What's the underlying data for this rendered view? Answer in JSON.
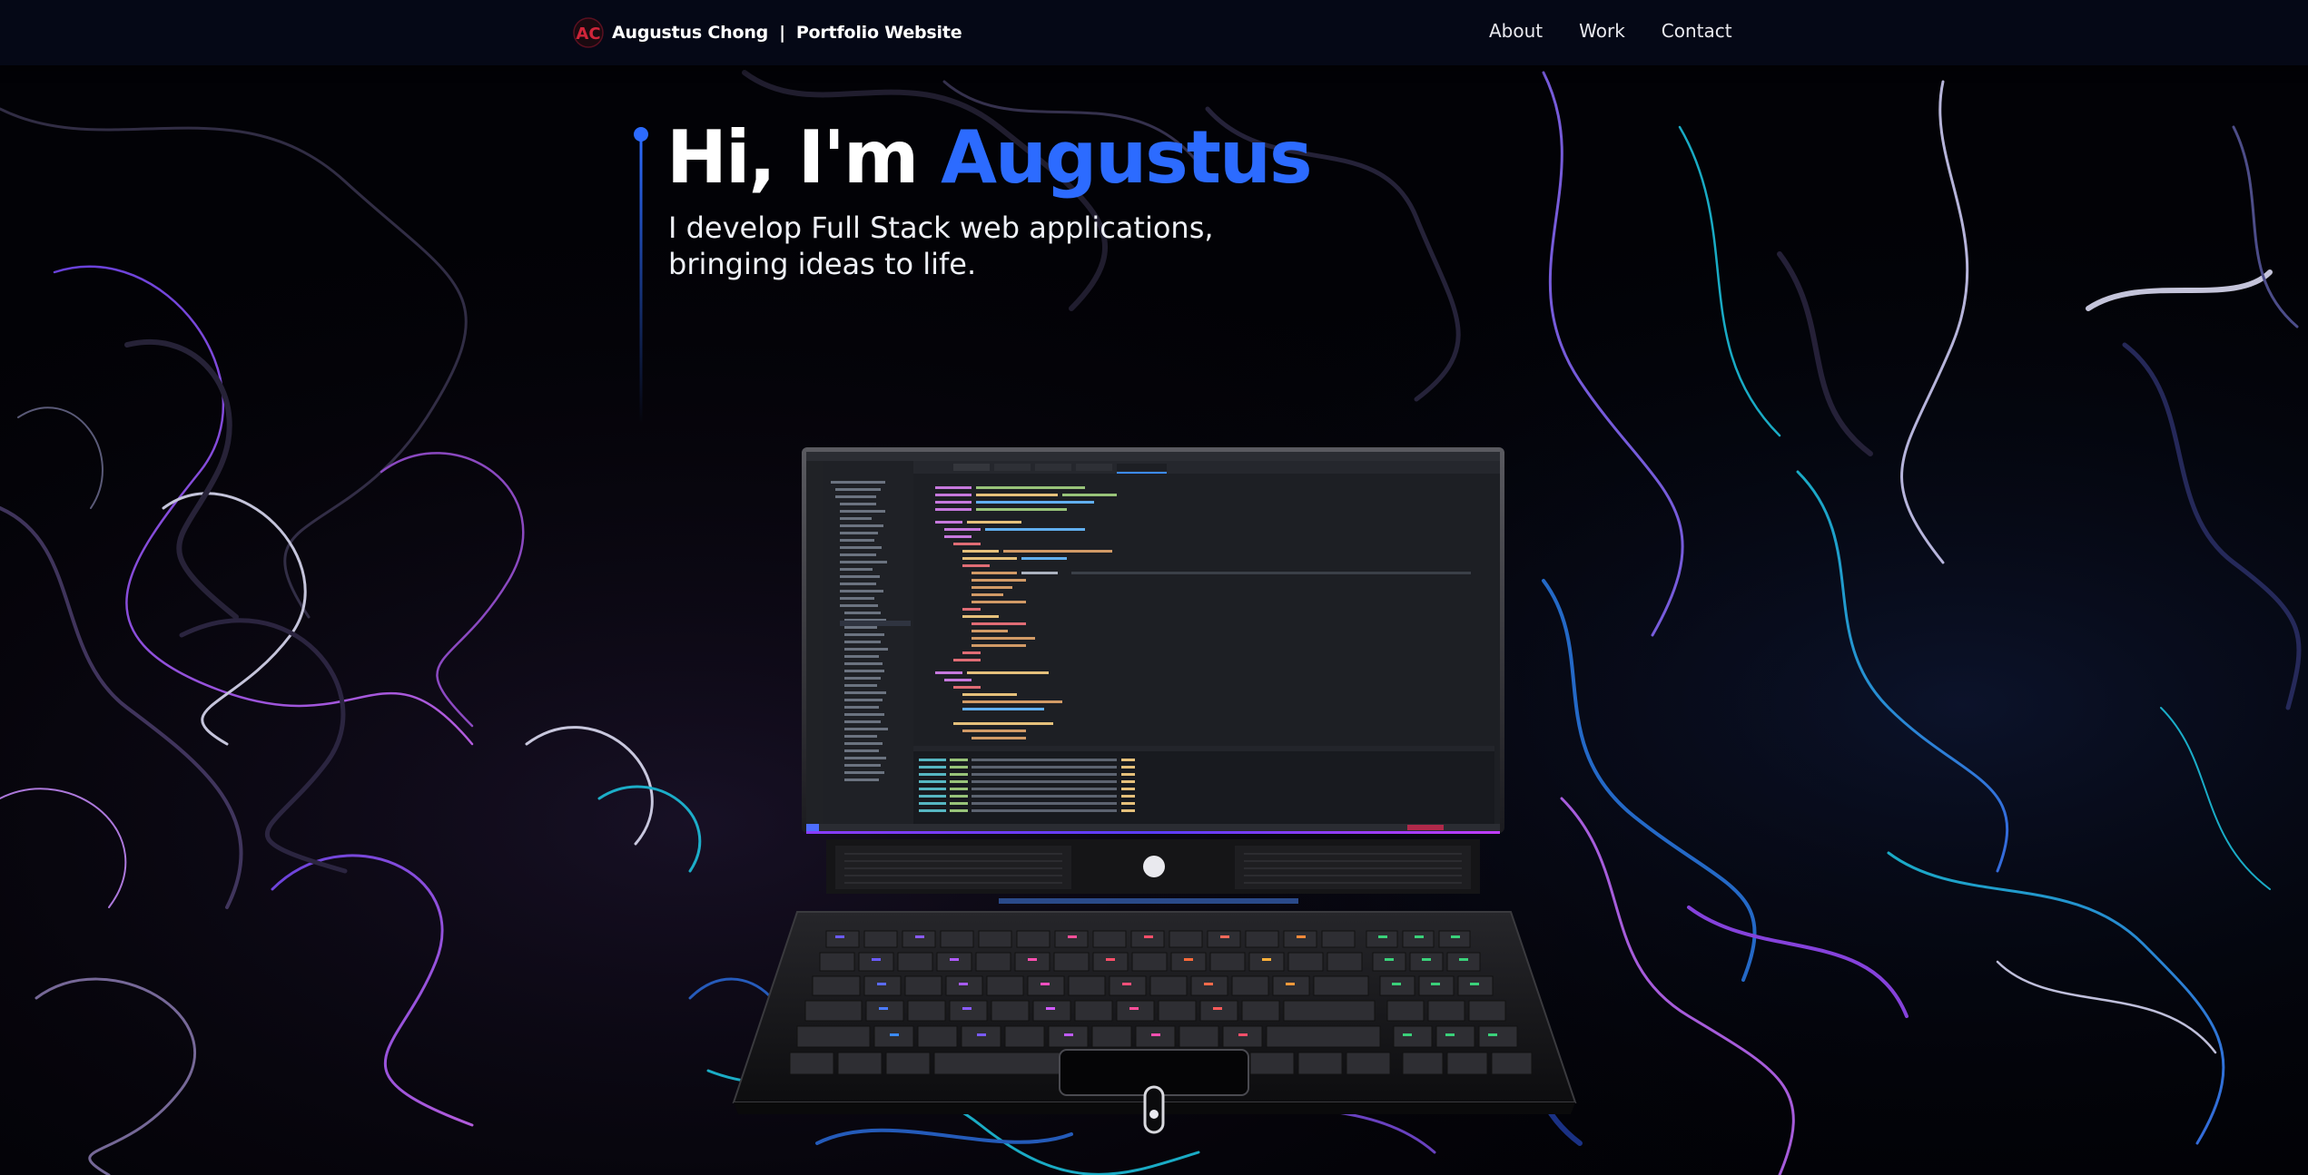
{
  "nav": {
    "logo_text": "AC",
    "brand_name": "Augustus Chong",
    "brand_separator": "|",
    "brand_tagline": "Portfolio Website",
    "links": [
      {
        "label": "About"
      },
      {
        "label": "Work"
      },
      {
        "label": "Contact"
      }
    ]
  },
  "hero": {
    "greeting": "Hi, I'm ",
    "name": "Augustus",
    "subtitle_line1": "I develop Full Stack web applications,",
    "subtitle_line2": "bringing ideas to life."
  },
  "colors": {
    "accent": "#2c6bff",
    "nav_bg": "#050816",
    "page_bg": "#010103",
    "logo_red": "#d0253a"
  },
  "icons": {
    "logo": "ac-monogram-logo",
    "scroll": "scroll-indicator-icon"
  }
}
